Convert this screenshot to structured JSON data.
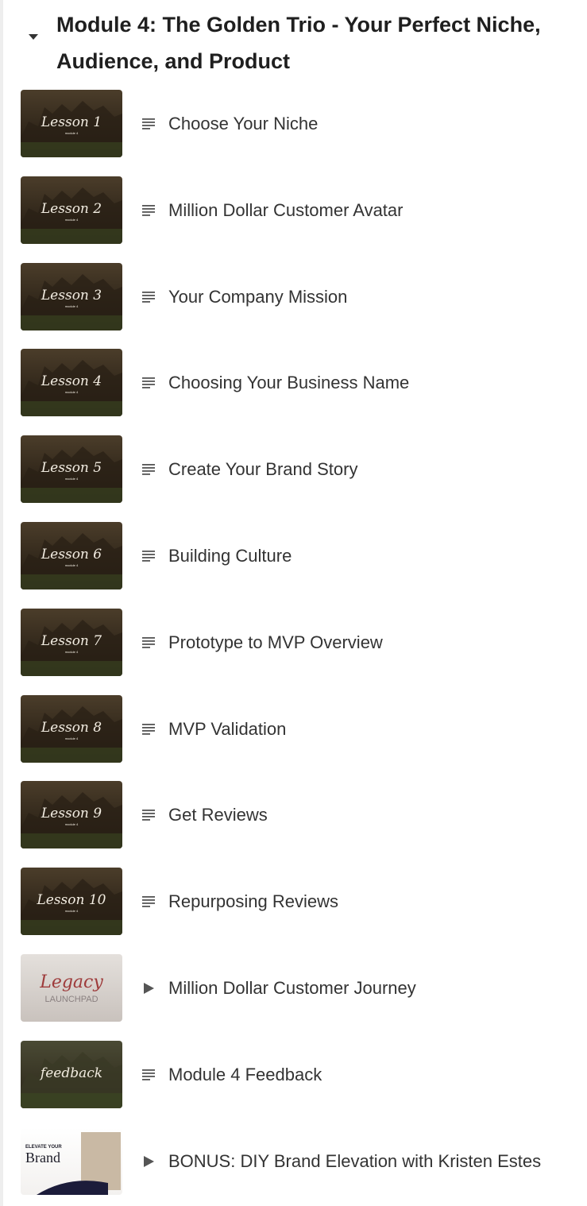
{
  "module": {
    "title": "Module 4: The Golden Trio - Your Perfect Niche, Audience, and Product"
  },
  "colors": {
    "text": "#333333",
    "icon": "#555555",
    "thumb_dark": "#2e2418",
    "thumb_light": "#d8d3cf"
  },
  "lessons": [
    {
      "label": "Choose Your Niche",
      "icon": "text-lines-icon",
      "thumb_text": "Lesson 1",
      "thumb_sub": "module 4",
      "thumb_style": "dark"
    },
    {
      "label": "Million Dollar Customer Avatar",
      "icon": "text-lines-icon",
      "thumb_text": "Lesson 2",
      "thumb_sub": "module 4",
      "thumb_style": "dark"
    },
    {
      "label": "Your Company Mission",
      "icon": "text-lines-icon",
      "thumb_text": "Lesson 3",
      "thumb_sub": "module 4",
      "thumb_style": "dark"
    },
    {
      "label": "Choosing Your Business Name",
      "icon": "text-lines-icon",
      "thumb_text": "Lesson 4",
      "thumb_sub": "module 4",
      "thumb_style": "dark"
    },
    {
      "label": "Create Your Brand Story",
      "icon": "text-lines-icon",
      "thumb_text": "Lesson 5",
      "thumb_sub": "module 4",
      "thumb_style": "dark"
    },
    {
      "label": "Building Culture",
      "icon": "text-lines-icon",
      "thumb_text": "Lesson 6",
      "thumb_sub": "module 4",
      "thumb_style": "dark"
    },
    {
      "label": "Prototype to MVP Overview",
      "icon": "text-lines-icon",
      "thumb_text": "Lesson 7",
      "thumb_sub": "module 4",
      "thumb_style": "dark"
    },
    {
      "label": "MVP Validation",
      "icon": "text-lines-icon",
      "thumb_text": "Lesson 8",
      "thumb_sub": "module 4",
      "thumb_style": "dark"
    },
    {
      "label": "Get Reviews",
      "icon": "text-lines-icon",
      "thumb_text": "Lesson 9",
      "thumb_sub": "module 4",
      "thumb_style": "dark"
    },
    {
      "label": "Repurposing Reviews",
      "icon": "text-lines-icon",
      "thumb_text": "Lesson 10",
      "thumb_sub": "module 4",
      "thumb_style": "dark"
    },
    {
      "label": "Million Dollar Customer Journey",
      "icon": "play-icon",
      "thumb_text": "Legacy",
      "thumb_sub": "LAUNCHPAD",
      "thumb_style": "light"
    },
    {
      "label": "Module 4 Feedback",
      "icon": "text-lines-icon",
      "thumb_text": "feedback",
      "thumb_sub": "",
      "thumb_style": "forest"
    },
    {
      "label": "BONUS: DIY Brand Elevation with Kristen Estes",
      "icon": "play-icon",
      "thumb_text": "Brand",
      "thumb_sub": "ELEVATE YOUR",
      "thumb_style": "bonus"
    }
  ]
}
